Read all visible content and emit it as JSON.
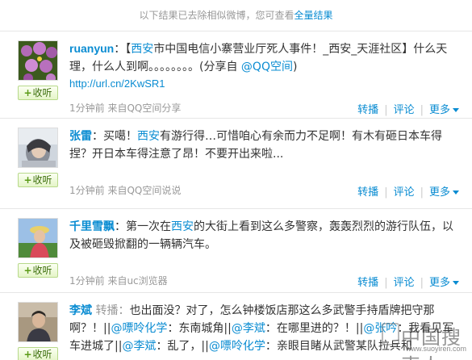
{
  "notice": {
    "text": "以下结果已去除相似微博，您可查看",
    "link": "全量结果"
  },
  "follow_label": "收听",
  "actions": {
    "repost": "转播",
    "comment": "评论",
    "more": "更多"
  },
  "posts": [
    {
      "author": "ruanyun",
      "text_before": "：【",
      "highlight": "西安",
      "text_after": "市中国电信小寨营业厅死人事件！_西安_天涯社区】什么天理，什么人到啊。。。。。。。。(分享自 ",
      "share_link": "@QQ空间",
      "text_end": ")",
      "short_url": "http://url.cn/2KwSR1",
      "meta": "1分钟前 来自QQ空间分享"
    },
    {
      "author": "张雷",
      "text_before": "：买噶！",
      "highlight": "西安",
      "text_after": "有游行得…可惜咱心有余而力不足啊！有木有砸日本车得捏？开日本车得注意了昂！不要开出来啦...",
      "meta": "1分钟前 来自QQ空间说说"
    },
    {
      "author": "千里雪飘",
      "text_before": "：第一次在",
      "highlight": "西安",
      "text_after": "的大街上看到这么多警察，轰轰烈烈的游行队伍，以及被砸毁掀翻的一辆辆汽车。",
      "meta": "1分钟前 来自uc浏览器"
    },
    {
      "author": "李斌",
      "repost_tag": " 转播：",
      "line1": "也出面没？对了，怎么钟楼饭店那这么多武警手持盾牌把守那啊？！||",
      "user_a": "@嘌呤化学",
      "seg_a": "：东南城角||",
      "user_b": "@李斌",
      "seg_b": "：在哪里进的？！||",
      "user_c": "@张吟",
      "seg_c": "：我看见军车进城了",
      "seg_d": "||",
      "user_d": "@李斌",
      "seg_e": "：乱了，||",
      "user_e": "@嘌呤化学",
      "seg_f": "：亲眼目睹从武警某队拉兵和"
    }
  ],
  "watermark": {
    "text": "中国搜索人",
    "url": "www.suoyiren.com"
  }
}
